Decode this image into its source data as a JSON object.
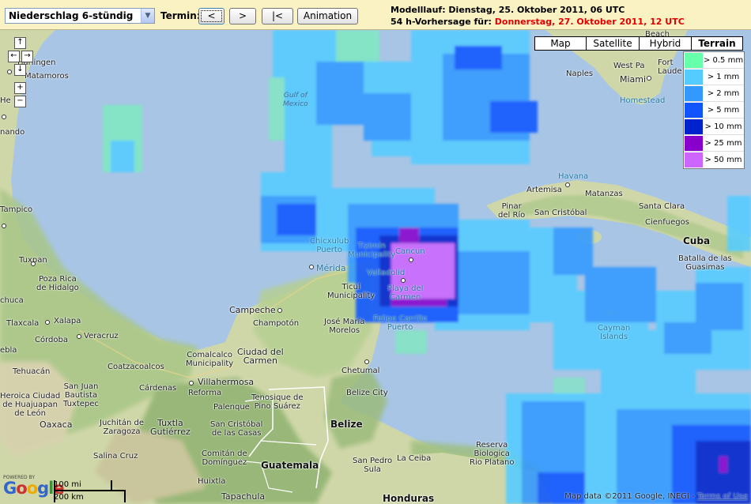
{
  "toolbar": {
    "product": "Niederschlag 6-stündig",
    "termin_label": "Termin:",
    "btn_prev": "<",
    "btn_next": ">",
    "btn_first": "|<",
    "btn_animation": "Animation",
    "run_line": "Modelllauf: Dienstag, 25. Oktober 2011, 06 UTC",
    "forecast_prefix": "54 h-Vorhersage für:",
    "forecast_date": "Donnerstag, 27. Oktober 2011, 12 UTC"
  },
  "map_types": [
    "Map",
    "Satellite",
    "Hybrid",
    "Terrain"
  ],
  "map_type_selected": "Terrain",
  "legend": [
    {
      "label": "> 0.5 mm",
      "color": "#66ffaa"
    },
    {
      "label": "> 1 mm",
      "color": "#55ccff"
    },
    {
      "label": "> 2 mm",
      "color": "#3399ff"
    },
    {
      "label": "> 5 mm",
      "color": "#1155ff"
    },
    {
      "label": "> 10 mm",
      "color": "#0022cc"
    },
    {
      "label": "> 25 mm",
      "color": "#8800cc"
    },
    {
      "label": "> 50 mm",
      "color": "#cc66ff"
    }
  ],
  "places": {
    "harlingen": "Harlingen",
    "matamoros": "Matamoros",
    "nando": "nando",
    "he": "He",
    "gulf": "Gulf of\nMexico",
    "tampico": "Tampico",
    "tuxpan": "Tuxpan",
    "poza_rica": "Poza Rica\nde Hidalgo",
    "chuca": "chuca",
    "xalapa": "Xalapa",
    "tlaxcala": "Tlaxcala",
    "cordoba": "Córdoba",
    "veracruz": "Veracruz",
    "ebla": "ebla",
    "tehuacan": "Tehuacán",
    "coatzacoalcos": "Coatzacoalcos",
    "comalcalco": "Comalcalco\nMunicipality",
    "ciudad_carmen": "Ciudad del\nCarmen",
    "campeche": "Campeche",
    "champoton": "Champotón",
    "cardenas": "Cárdenas",
    "villahermosa": "Villahermosa",
    "reforma": "Reforma",
    "tenosique": "Tenosique de\nPino Suárez",
    "palenque": "Palenque",
    "san_juan": "San Juan\nBautista\nTuxtepec",
    "heroica": "Heroica Ciudad\nde Huajuapan\nde León",
    "oaxaca": "Oaxaca",
    "juchitan": "Juchitán de\nZaragoza",
    "tuxtla": "Tuxtla\nGutiérrez",
    "san_cristobal": "San Cristóbal\nde las Casas",
    "salina_cruz": "Salina Cruz",
    "comitan": "Comitán de\nDomínguez",
    "huixtla": "Huixtla",
    "tapachula": "Tapachula",
    "guatemala": "Guatemala",
    "belize_city": "Belize City",
    "belize": "Belize",
    "chetumal": "Chetumal",
    "san_pedro": "San Pedro\nSula",
    "la_ceiba": "La Ceiba",
    "honduras": "Honduras",
    "reserva": "Reserva\nBiologica\nRio Platano",
    "merida": "Mérida",
    "chicxulub": "Chicxulub\nPuerto",
    "tizimin": "Tizimín\nMunicipality",
    "valladolid": "Valladolid",
    "ticul": "Ticul\nMunicipality",
    "jose_maria": "José María\nMorelos",
    "felipe": "Felipe Carrillo\nPuerto",
    "cancun": "Cancun",
    "playa": "Playa del\nCarmen",
    "cayman": "Cayman\nIslands",
    "havana": "Havana",
    "artemisa": "Artemisa",
    "matanzas": "Matanzas",
    "pinar": "Pinar\ndel Río",
    "san_cristobal_cu": "San Cristóbal",
    "santa_clara": "Santa Clara",
    "cienfuegos": "Cienfuegos",
    "cuba": "Cuba",
    "batalla": "Batalla de las\nGuasimas",
    "naples": "Naples",
    "miami": "Miami",
    "homestead": "Homestead",
    "west_palm": "West Pa",
    "beach": "Beach",
    "fort_laud": "Fort\nLaude"
  },
  "scale": {
    "miles": "100 mi",
    "km": "200 km"
  },
  "logo": {
    "powered": "POWERED BY",
    "google": "Google"
  },
  "copyright": {
    "text": "Map data ©2011 Google, INEGI - ",
    "link": "Terms of Use"
  }
}
